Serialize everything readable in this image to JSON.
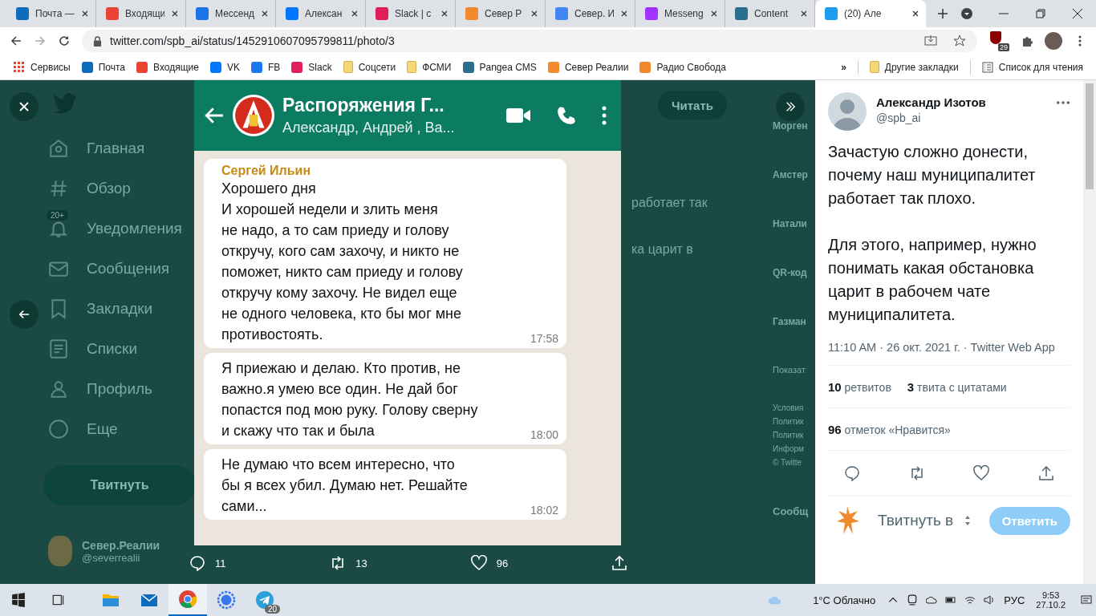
{
  "browser": {
    "tabs": [
      {
        "title": "Почта —",
        "color": "#0f6cbd",
        "selected": false
      },
      {
        "title": "Входящи",
        "color": "#ea4335",
        "selected": false
      },
      {
        "title": "Мессенд",
        "color": "#1a73e8",
        "selected": false
      },
      {
        "title": "Алексан",
        "color": "#0077ff",
        "selected": false
      },
      {
        "title": "Slack | c",
        "color": "#e01e5a",
        "selected": false
      },
      {
        "title": "Север Р",
        "color": "#f08a2c",
        "selected": false
      },
      {
        "title": "Север. И",
        "color": "#4285f4",
        "selected": false
      },
      {
        "title": "Messeng",
        "color": "#a033ff",
        "selected": false
      },
      {
        "title": "Content",
        "color": "#2a6f8f",
        "selected": false
      },
      {
        "title": "(20) Але",
        "color": "#1d9bf0",
        "selected": true
      }
    ],
    "address": "twitter.com/spb_ai/status/1452910607095799811/photo/3",
    "extension_badge": "29",
    "bookmarks": [
      {
        "label": "Сервисы",
        "kind": "apps",
        "color": "#ea4335"
      },
      {
        "label": "Почта",
        "kind": "site",
        "color": "#0f6cbd"
      },
      {
        "label": "Входящие",
        "kind": "site",
        "color": "#ea4335"
      },
      {
        "label": "VK",
        "kind": "site",
        "color": "#0077ff"
      },
      {
        "label": "FB",
        "kind": "site",
        "color": "#1877f2"
      },
      {
        "label": "Slack",
        "kind": "site",
        "color": "#e01e5a"
      },
      {
        "label": "Соцсети",
        "kind": "folder",
        "color": "#f6d776"
      },
      {
        "label": "ФСМИ",
        "kind": "folder",
        "color": "#f6d776"
      },
      {
        "label": "Pangea CMS",
        "kind": "site",
        "color": "#2a6f8f"
      },
      {
        "label": "Север Реалии",
        "kind": "site",
        "color": "#f08a2c"
      },
      {
        "label": "Радио Свобода",
        "kind": "site",
        "color": "#f08a2c"
      }
    ],
    "more_bookmarks": "»",
    "other_bookmarks": "Другие закладки",
    "reading_list": "Список для чтения"
  },
  "background": {
    "nav": [
      {
        "label": "Главная",
        "kind": "home"
      },
      {
        "label": "Обзор",
        "kind": "hash"
      },
      {
        "label": "Уведомления",
        "kind": "bell",
        "badge": "20+"
      },
      {
        "label": "Сообщения",
        "kind": "mail"
      },
      {
        "label": "Закладки",
        "kind": "bookmark"
      },
      {
        "label": "Списки",
        "kind": "list"
      },
      {
        "label": "Профиль",
        "kind": "person"
      },
      {
        "label": "Еще",
        "kind": "more"
      }
    ],
    "tweet_button": "Твитнуть",
    "account": {
      "name": "Север.Реалии",
      "handle": "@severrealii"
    },
    "read_button": "Читать",
    "fragments": [
      "работает так",
      "ка царит в"
    ],
    "trends": [
      "Морген",
      "Амстер",
      "Натали",
      "QR-код",
      "Газман"
    ],
    "show_more": "Показат",
    "footer": [
      "Условия",
      "Политик",
      "Политик",
      "Информ",
      "© Twitte"
    ],
    "messages_heading": "Сообщ"
  },
  "photo": {
    "chat_title": "Распоряжения Г...",
    "chat_members": "Александр, Андрей , Ва...",
    "messages": [
      {
        "sender": "Сергей Ильин",
        "text": "Хорошего дня\n И хорошей недели и злить меня\nне надо, а то сам приеду  и голову\nоткручу, кого сам захочу, и никто не\nпоможет, никто сам приеду и голову\nоткручу кому захочу. Не видел еще\nне одного человека, кто бы мог мне\nпротивостоять.",
        "time": "17:58"
      },
      {
        "text": "Я приежаю и делаю. Кто против, не\nважно.я умею все один. Не дай бог\nпопастся под мою руку. Голову сверну\nи скажу что так и была",
        "time": "18:00"
      },
      {
        "text": "Не думаю что всем интересно, что\nбы я всех убил. Думаю нет. Решайте\nсами...",
        "time": "18:02"
      }
    ]
  },
  "photo_actions": {
    "replies": "11",
    "retweets": "13",
    "likes": "96"
  },
  "tweet": {
    "name": "Александр Изотов",
    "handle": "@spb_ai",
    "text": "Зачастую сложно донести, почему наш муниципалитет работает так плохо.\n\nДля этого, например, нужно понимать какая обстановка царит в рабочем чате муниципалитета.",
    "meta": "11:10 AM · 26 окт. 2021 г. · Twitter Web App",
    "retweets_count": "10",
    "retweets_label": "ретвитов",
    "quotes_count": "3",
    "quotes_label": "твита с цитатами",
    "likes_count": "96",
    "likes_label": "отметок «Нравится»",
    "reply_placeholder": "Твитнуть в",
    "reply_button": "Ответить"
  },
  "taskbar": {
    "apps": [
      {
        "kind": "explorer",
        "selected": false
      },
      {
        "kind": "mail",
        "selected": false
      },
      {
        "kind": "chrome",
        "selected": true
      },
      {
        "kind": "signal",
        "selected": false
      },
      {
        "kind": "telegram",
        "selected": false,
        "badge": "20"
      }
    ],
    "weather": "1°C Облачно",
    "language": "РУС",
    "time": "9:53",
    "date": "27.10.2"
  }
}
